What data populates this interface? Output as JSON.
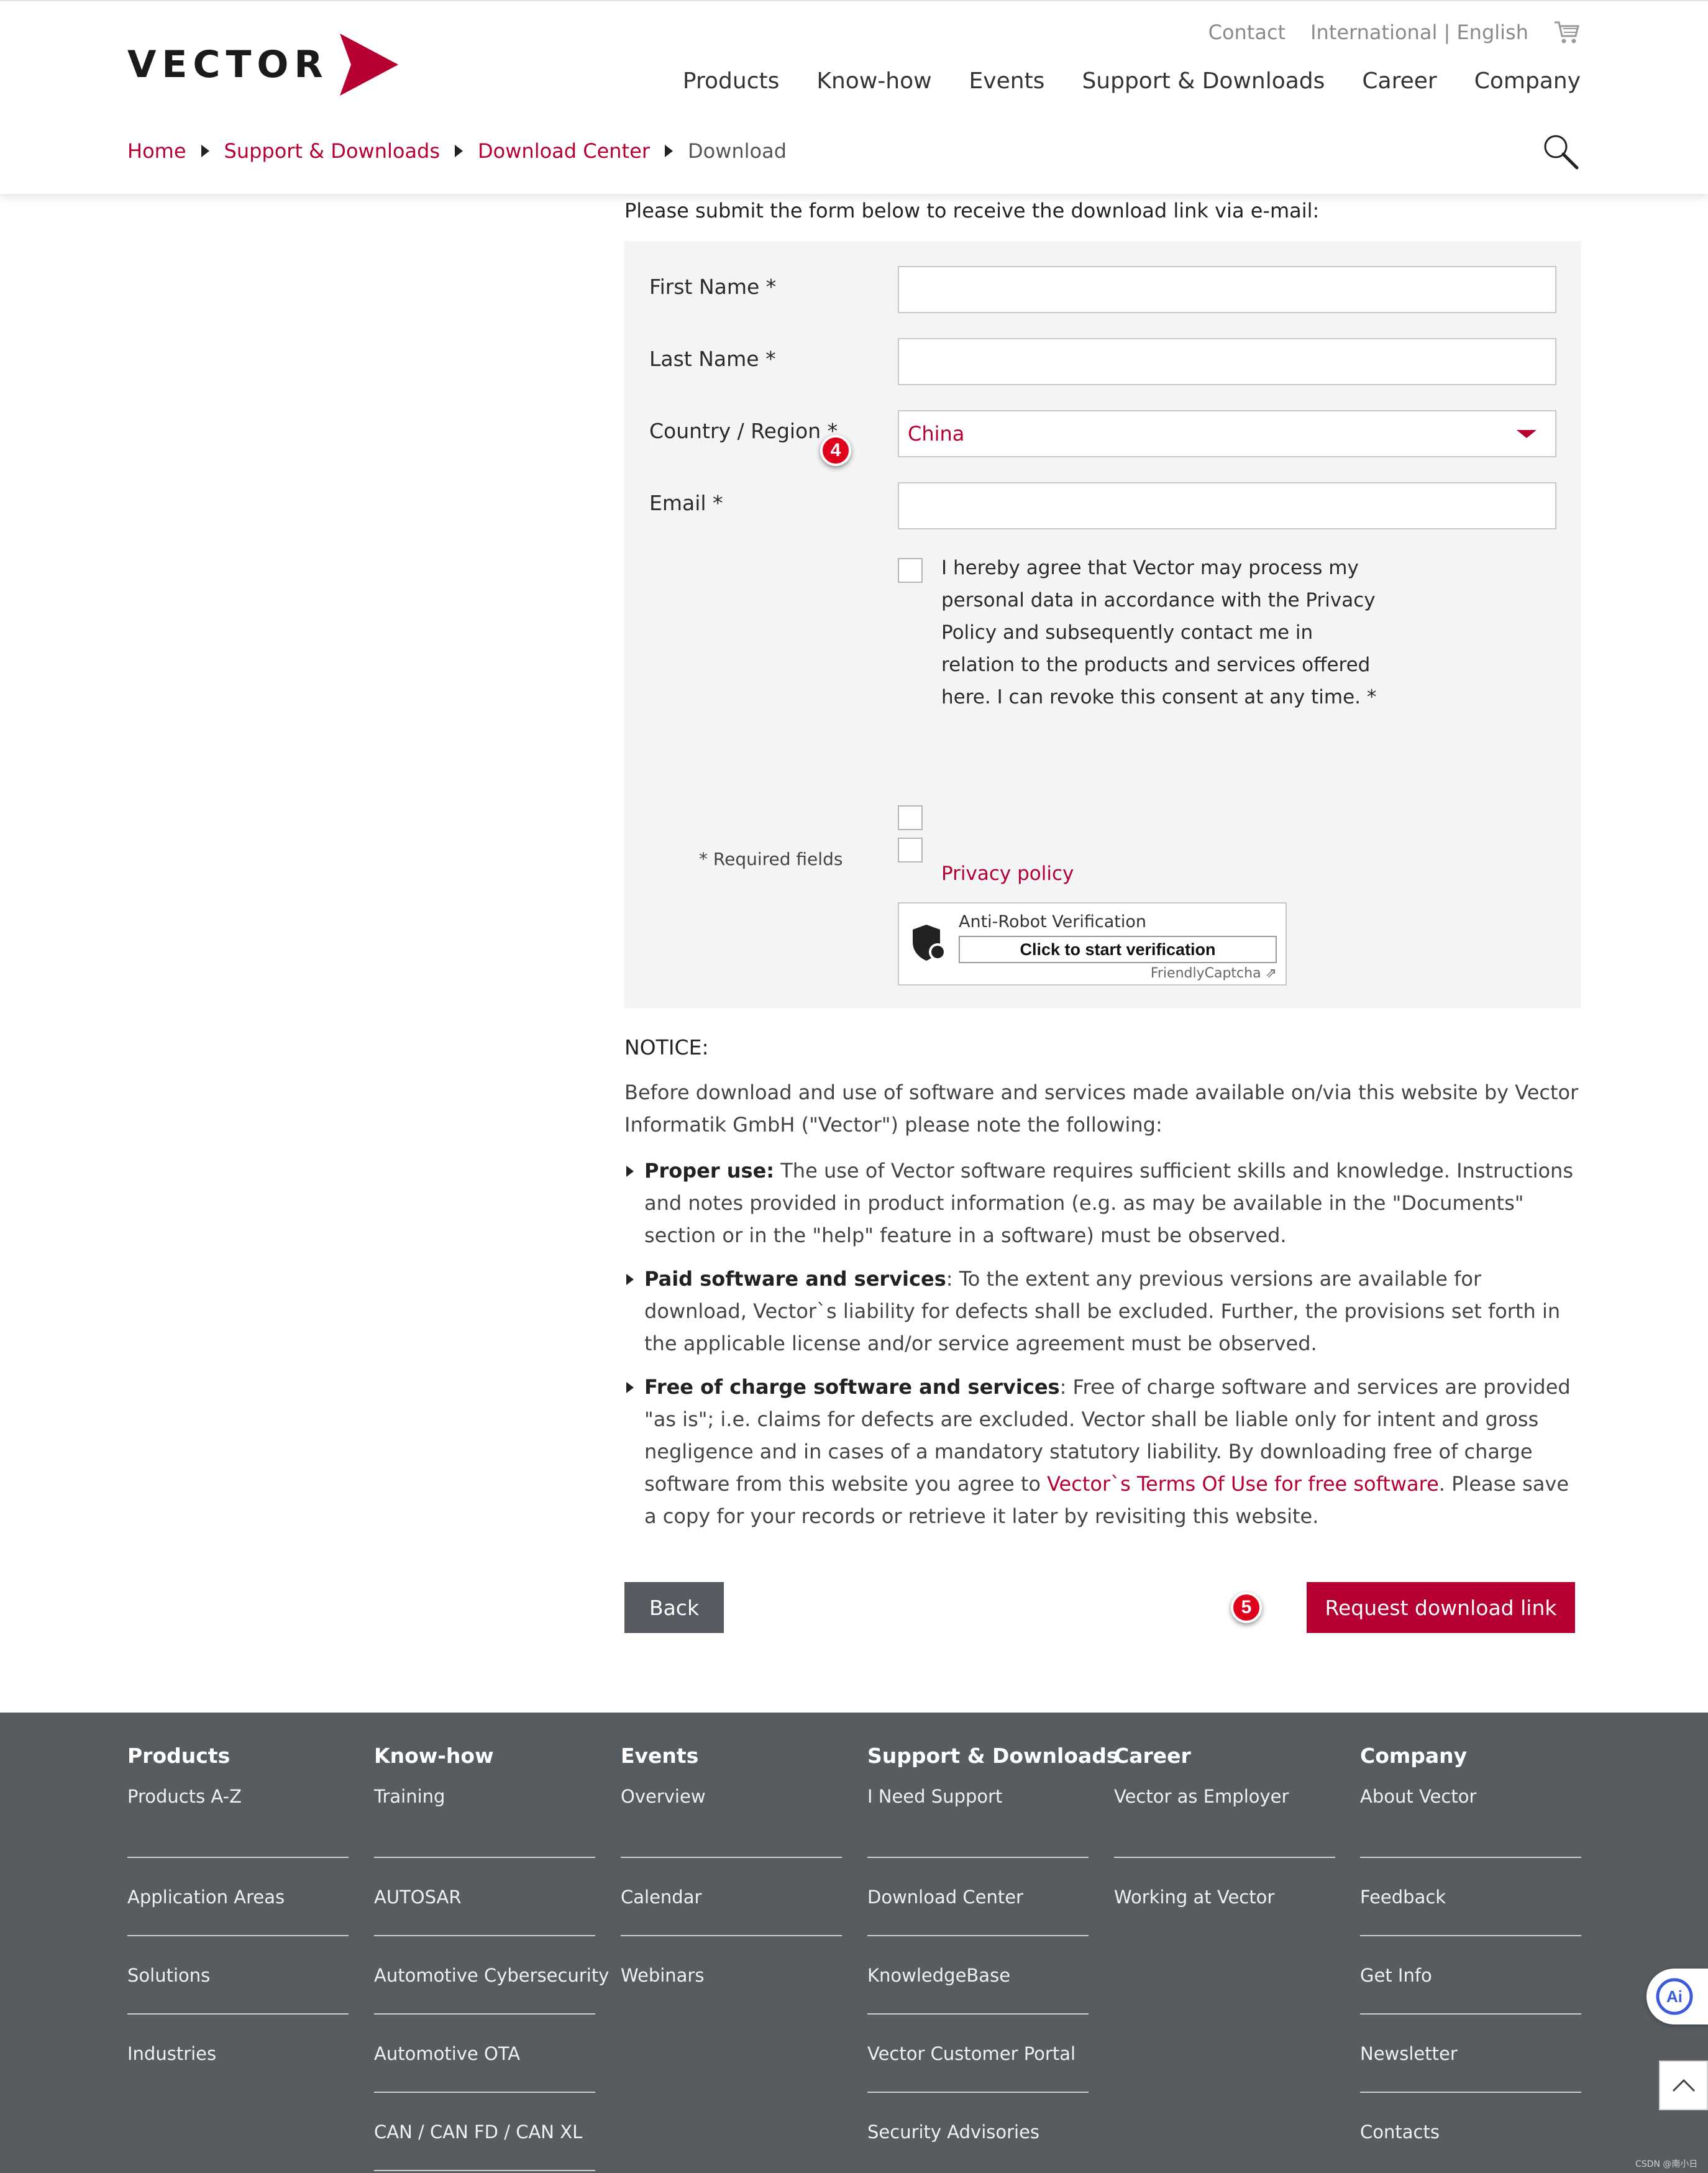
{
  "colors": {
    "brand": "#b70032",
    "footer_bg": "#575c60",
    "panel_bg": "#f3f4f6",
    "badge": "#e0001b"
  },
  "header": {
    "logo_text": "VECTOR",
    "topnav": {
      "contact": "Contact",
      "language": "International | English"
    },
    "mainnav": [
      "Products",
      "Know-how",
      "Events",
      "Support & Downloads",
      "Career",
      "Company"
    ],
    "breadcrumb": [
      "Home",
      "Support & Downloads",
      "Download Center",
      "Download"
    ]
  },
  "form": {
    "intro": "Please submit the form below to receive the download link via e-mail:",
    "first_name_label": "First Name *",
    "last_name_label": "Last Name *",
    "country_label": "Country / Region *",
    "country_value": "China",
    "email_label": "Email *",
    "consent_text": "I hereby agree that Vector may process my personal data in accordance with the Privacy Policy and subsequently contact me in relation to the products and services offered here. I can revoke this consent at any time. *",
    "privacy_link": "Privacy policy",
    "required_note": "* Required fields",
    "captcha": {
      "title": "Anti-Robot Verification",
      "button": "Click to start verification",
      "brand": "FriendlyCaptcha ⇗"
    },
    "badges": [
      "4",
      "5"
    ]
  },
  "notice": {
    "title": "NOTICE:",
    "intro": "Before download and use of software and services made available on/via this website by Vector Informatik GmbH (\"Vector\") please note the following:",
    "items": [
      {
        "bold": "Proper use:",
        "text": " The use of Vector software requires sufficient skills and knowledge. Instructions and notes provided in product information (e.g. as may be available in the \"Documents\" section or in the \"help\" feature in a software) must be observed."
      },
      {
        "bold": "Paid software and services",
        "text": ": To the extent any previous versions are available for download, Vector`s liability for defects shall be excluded. Further, the provisions set forth in the applicable license and/or service agreement must be observed."
      },
      {
        "bold": "Free of charge software and services",
        "text": ": Free of charge software and services are provided \"as is\"; i.e. claims for defects are excluded. Vector shall be liable only for intent and gross negligence and in cases of a mandatory statutory liability. By downloading free of charge software from this website you agree to ",
        "link": "Vector`s Terms Of Use for free software",
        "after": ". Please save a copy for your records or retrieve it later by revisiting this website."
      }
    ]
  },
  "buttons": {
    "back": "Back",
    "request": "Request download link"
  },
  "footer": {
    "columns": [
      {
        "heading": "Products",
        "links": [
          "Products A-Z",
          "Application Areas",
          "Solutions",
          "Industries"
        ]
      },
      {
        "heading": "Know-how",
        "links": [
          "Training",
          "AUTOSAR",
          "Automotive Cybersecurity",
          "Automotive OTA",
          "CAN / CAN FD / CAN XL"
        ]
      },
      {
        "heading": "Events",
        "links": [
          "Overview",
          "Calendar",
          "Webinars"
        ]
      },
      {
        "heading": "Support & Downloads",
        "links": [
          "I Need Support",
          "Download Center",
          "KnowledgeBase",
          "Vector Customer Portal",
          "Security Advisories"
        ]
      },
      {
        "heading": "Career",
        "links": [
          "Vector as Employer",
          "Working at Vector"
        ]
      },
      {
        "heading": "Company",
        "links": [
          "About Vector",
          "Feedback",
          "Get Info",
          "Newsletter",
          "Contacts"
        ]
      }
    ],
    "ai_label": "Ai",
    "watermark": "CSDN @南小日"
  }
}
